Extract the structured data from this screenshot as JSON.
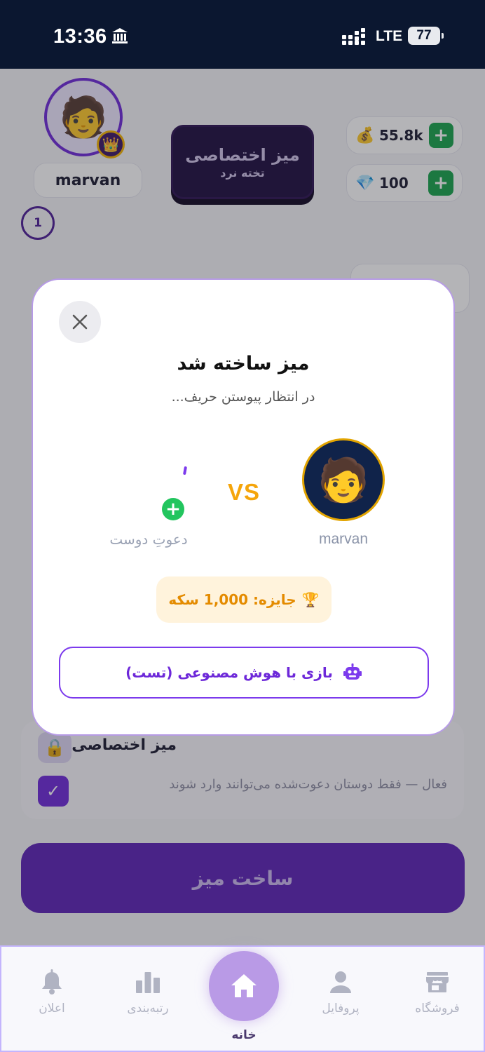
{
  "status_bar": {
    "time": "13:36",
    "network": "LTE",
    "battery": "77"
  },
  "profile": {
    "username": "marvan",
    "avatar_emoji": "🧑",
    "crown_emoji": "👑",
    "level": "1"
  },
  "header_card": {
    "title": "میز اختصاصی",
    "subtitle": "تخته نرد"
  },
  "wallet": {
    "coins": "55.8k",
    "coin_icon": "💰",
    "gems": "100",
    "gem_icon": "💎",
    "plus": "+"
  },
  "private_row": {
    "title": "میز اختصاصی",
    "lock_icon": "🔒",
    "checkmark": "✓",
    "description": "فعال — فقط دوستان دعوت‌شده می‌توانند وارد شوند"
  },
  "create_button": "ساخت میز",
  "modal": {
    "title": "میز ساخته شد",
    "subtitle": "در انتظار پیوستن حریف...",
    "player_name": "marvan",
    "player_avatar": "🧑",
    "vs": "VS",
    "invite_plus": "+",
    "invite_label": "دعوتِ دوست",
    "prize_icon": "🏆",
    "prize_text": "جایزه: 1,000 سکه",
    "ai_button": "بازی با هوش مصنوعی (تست)"
  },
  "nav": {
    "shop": "فروشگاه",
    "profile": "پروفایل",
    "home": "خانه",
    "ranking": "رتبه‌بندی",
    "notifications": "اعلان"
  },
  "colors": {
    "accent": "#7c3aed",
    "header_bg": "#0b1730",
    "gold": "#f5a50b",
    "green": "#22c55e"
  }
}
